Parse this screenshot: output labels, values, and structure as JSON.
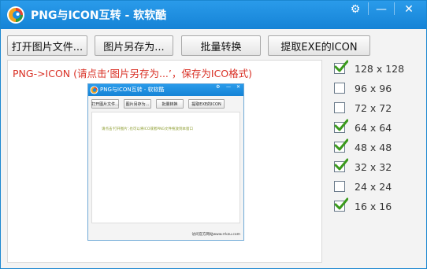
{
  "window": {
    "title": "PNG与ICON互转 - 软软酷",
    "controls": {
      "settings": "⚙",
      "minimize": "—",
      "close": "✕"
    }
  },
  "toolbar": {
    "open_label": "打开图片文件...",
    "save_as_label": "图片另存为...",
    "batch_label": "批量转换",
    "extract_label": "提取EXE的ICON"
  },
  "preview": {
    "hint": "PNG->ICON (请点击‘图片另存为...’，保存为ICO格式)",
    "thumb": {
      "title": "PNG与ICON互转 - 软软酷",
      "controls": {
        "settings": "⚙",
        "minimize": "—",
        "close": "✕"
      },
      "buttons": [
        "打开图片文件...",
        "图片另存为...",
        "批量转换",
        "提取EXE的ICON"
      ],
      "message": "请点击'打开图片',也可以将ICO或者PNG文件拖放到本窗口",
      "status": "访问官方网站www.rrkzu.com"
    }
  },
  "sizes": [
    {
      "label": "128 x 128",
      "checked": true
    },
    {
      "label": "96 x 96",
      "checked": false
    },
    {
      "label": "72 x 72",
      "checked": false
    },
    {
      "label": "64 x 64",
      "checked": true
    },
    {
      "label": "48 x 48",
      "checked": true
    },
    {
      "label": "32 x 32",
      "checked": true
    },
    {
      "label": "24 x 24",
      "checked": false
    },
    {
      "label": "16 x 16",
      "checked": true
    }
  ],
  "colors": {
    "titlebar": "#1a8ce0",
    "hint_text": "#d93025",
    "check": "#3a9a1c"
  }
}
